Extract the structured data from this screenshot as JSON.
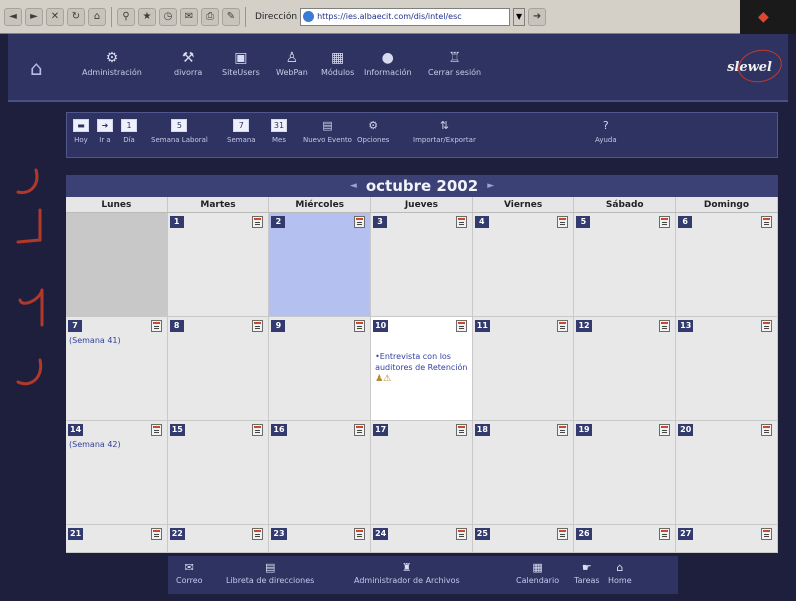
{
  "browser": {
    "address_label": "Dirección",
    "address_value": "https://ies.albaecit.com/dis/intel/esc",
    "go_label": "Ir"
  },
  "header": {
    "brand": "slewel",
    "nav": [
      {
        "label": "Administración",
        "icon": "admin-icon"
      },
      {
        "label": "divorra",
        "icon": "tools-icon"
      },
      {
        "label": "SiteUsers",
        "icon": "site-icon"
      },
      {
        "label": "WebPan",
        "icon": "web-icon"
      },
      {
        "label": "Módulos",
        "icon": "modules-icon"
      },
      {
        "label": "Información",
        "icon": "info-icon"
      },
      {
        "label": "Cerrar sesión",
        "icon": "logout-icon"
      }
    ]
  },
  "toolbar": {
    "items": [
      {
        "label": "Hoy",
        "icon": "today-icon"
      },
      {
        "label": "Ir a",
        "icon": "goto-icon"
      },
      {
        "label": "Día",
        "icon": "day-icon"
      },
      {
        "label": "Semana Laboral",
        "icon": "workweek-icon"
      },
      {
        "label": "Semana",
        "icon": "week-icon"
      },
      {
        "label": "Mes",
        "icon": "month-icon"
      },
      {
        "label": "Nuevo Evento",
        "icon": "new-event-icon"
      },
      {
        "label": "Opciones",
        "icon": "options-icon"
      },
      {
        "label": "Importar/Exportar",
        "icon": "import-export-icon"
      },
      {
        "label": "Ayuda",
        "icon": "help-icon"
      }
    ]
  },
  "calendar": {
    "month_title": "octubre 2002",
    "weekdays": [
      "Lunes",
      "Martes",
      "Miércoles",
      "Jueves",
      "Viernes",
      "Sábado",
      "Domingo"
    ],
    "weeks": [
      {
        "week_label": "",
        "days": [
          "",
          "1",
          "2",
          "3",
          "4",
          "5",
          "6"
        ]
      },
      {
        "week_label": "(Semana 41)",
        "days": [
          "7",
          "8",
          "9",
          "10",
          "11",
          "12",
          "13"
        ]
      },
      {
        "week_label": "(Semana 42)",
        "days": [
          "14",
          "15",
          "16",
          "17",
          "18",
          "19",
          "20"
        ]
      },
      {
        "week_label": "",
        "days": [
          "21",
          "22",
          "23",
          "24",
          "25",
          "26",
          "27"
        ]
      }
    ],
    "today_day": "2",
    "event": {
      "day": "10",
      "text": "•Entrevista con los auditores de Retención"
    }
  },
  "footer": {
    "items": [
      {
        "label": "Correo",
        "icon": "mail-icon"
      },
      {
        "label": "Libreta de direcciones",
        "icon": "addressbook-icon"
      },
      {
        "label": "Administrador de Archivos",
        "icon": "files-icon"
      },
      {
        "label": "Calendario",
        "icon": "calendar-icon"
      },
      {
        "label": "Tareas",
        "icon": "tasks-icon"
      },
      {
        "label": "Home",
        "icon": "home-icon"
      }
    ]
  }
}
